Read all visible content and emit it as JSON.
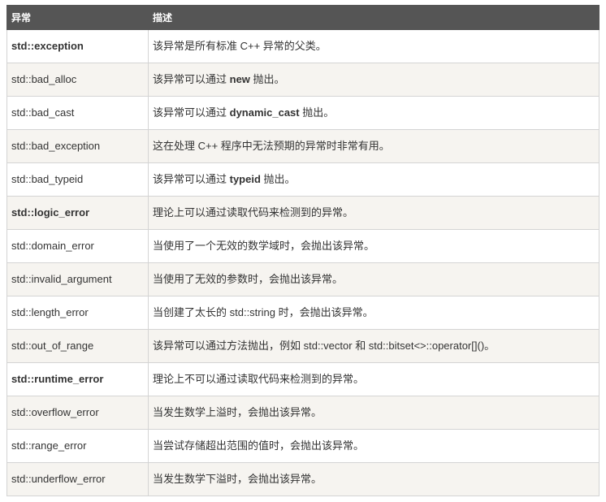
{
  "headers": {
    "col1": "异常",
    "col2": "描述"
  },
  "rows": [
    {
      "name": "std::exception",
      "bold": true,
      "desc": "该异常是所有标准 C++ 异常的父类。"
    },
    {
      "name": "std::bad_alloc",
      "bold": false,
      "desc_pre": "该异常可以通过 ",
      "desc_kw": "new",
      "desc_post": " 抛出。"
    },
    {
      "name": "std::bad_cast",
      "bold": false,
      "desc_pre": "该异常可以通过 ",
      "desc_kw": "dynamic_cast",
      "desc_post": " 抛出。"
    },
    {
      "name": "std::bad_exception",
      "bold": false,
      "desc": "这在处理 C++ 程序中无法预期的异常时非常有用。"
    },
    {
      "name": "std::bad_typeid",
      "bold": false,
      "desc_pre": "该异常可以通过 ",
      "desc_kw": "typeid",
      "desc_post": " 抛出。"
    },
    {
      "name": "std::logic_error",
      "bold": true,
      "desc": "理论上可以通过读取代码来检测到的异常。"
    },
    {
      "name": "std::domain_error",
      "bold": false,
      "desc": "当使用了一个无效的数学域时，会抛出该异常。"
    },
    {
      "name": "std::invalid_argument",
      "bold": false,
      "desc": "当使用了无效的参数时，会抛出该异常。"
    },
    {
      "name": "std::length_error",
      "bold": false,
      "desc": "当创建了太长的 std::string 时，会抛出该异常。"
    },
    {
      "name": "std::out_of_range",
      "bold": false,
      "desc": "该异常可以通过方法抛出，例如 std::vector 和 std::bitset<>::operator[]()。"
    },
    {
      "name": "std::runtime_error",
      "bold": true,
      "desc": "理论上不可以通过读取代码来检测到的异常。"
    },
    {
      "name": "std::overflow_error",
      "bold": false,
      "desc": "当发生数学上溢时，会抛出该异常。"
    },
    {
      "name": "std::range_error",
      "bold": false,
      "desc": "当尝试存储超出范围的值时，会抛出该异常。"
    },
    {
      "name": "std::underflow_error",
      "bold": false,
      "desc": "当发生数学下溢时，会抛出该异常。"
    }
  ]
}
